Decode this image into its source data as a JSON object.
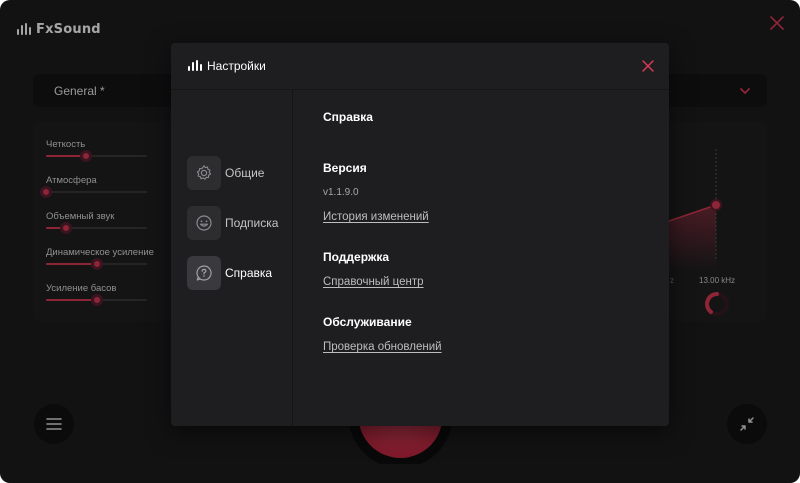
{
  "app": {
    "brand_name": "FxSound"
  },
  "main": {
    "preset": "General *",
    "effects": [
      {
        "label": "Четкость",
        "value": 0.4
      },
      {
        "label": "Атмосфера",
        "value": 0.0
      },
      {
        "label": "Объемный звук",
        "value": 0.2
      },
      {
        "label": "Динамическое усиление",
        "value": 0.5
      },
      {
        "label": "Усиление басов",
        "value": 0.5
      }
    ],
    "eq": {
      "freq_label": "13.00 kHz",
      "prev_tick": "z"
    }
  },
  "settings": {
    "title": "Настройки",
    "nav": [
      {
        "label": "Общие",
        "icon": "gear-icon",
        "active": false
      },
      {
        "label": "Подписка",
        "icon": "smiley-icon",
        "active": false
      },
      {
        "label": "Справка",
        "icon": "help-bubble-icon",
        "active": true
      }
    ],
    "help": {
      "heading": "Справка",
      "version_heading": "Версия",
      "version_value": "v1.1.9.0",
      "changelog_link": "История изменений",
      "support_heading": "Поддержка",
      "help_center_link": "Справочный центр",
      "maintenance_heading": "Обслуживание",
      "check_updates_link": "Проверка обновлений"
    }
  },
  "colors": {
    "accent": "#d93a55",
    "background": "#1c1c1e",
    "modal": "#1e1e20"
  }
}
